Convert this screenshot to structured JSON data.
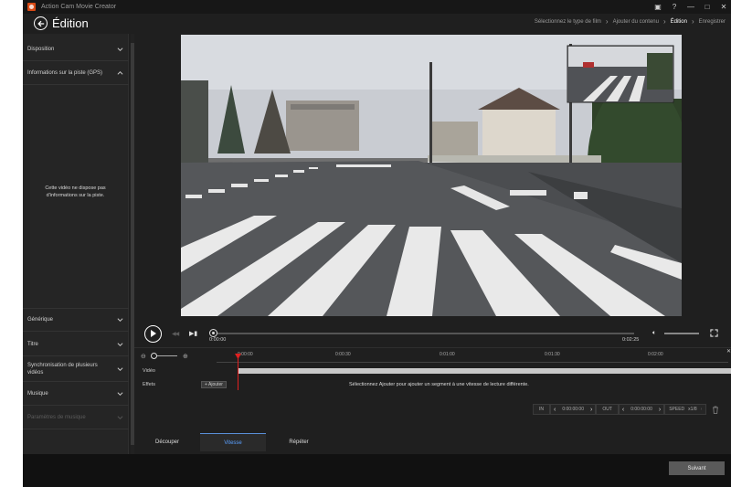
{
  "window": {
    "app_title": "Action Cam Movie Creator",
    "controls": [
      "toolbox",
      "help",
      "minimize",
      "maximize",
      "close"
    ]
  },
  "header": {
    "title": "Édition",
    "breadcrumb": [
      "Sélectionnez le type de film",
      "Ajouter du contenu",
      "Édition",
      "Enregistrer"
    ],
    "active_step": "Édition"
  },
  "left_panel": {
    "sections": [
      {
        "label": "Disposition",
        "expanded": false,
        "enabled": true
      },
      {
        "label": "Informations sur la piste (GPS)",
        "expanded": true,
        "enabled": true
      },
      {
        "label": "Générique",
        "expanded": false,
        "enabled": true
      },
      {
        "label": "Titre",
        "expanded": false,
        "enabled": true
      },
      {
        "label": "Synchronisation de plusieurs vidéos",
        "expanded": false,
        "enabled": true
      },
      {
        "label": "Musique",
        "expanded": false,
        "enabled": true
      },
      {
        "label": "Paramètres de musique",
        "expanded": false,
        "enabled": false
      }
    ],
    "gps_message": "Cette vidéo ne dispose pas d'informations sur la piste."
  },
  "player": {
    "current_time": "0:00:00",
    "total_time": "0:02:25",
    "progress": 0.0
  },
  "timeline": {
    "ruler_labels": [
      "0:00:00",
      "0:00:30",
      "0:01:00",
      "0:01:30",
      "0:02:00"
    ],
    "track_video_label": "Vidéo",
    "track_effects_label": "Effets",
    "add_button": "Ajouter",
    "hint": "Sélectionnez Ajouter pour ajouter un segment à une vitesse de lecture différente.",
    "in_label": "IN",
    "in_value": "0:00:00:00",
    "out_label": "OUT",
    "out_value": "0:00:00:00",
    "speed_label": "SPEED",
    "speed_value": "x1/8"
  },
  "tabs": [
    {
      "label": "Découper",
      "active": false
    },
    {
      "label": "Vitesse",
      "active": true
    },
    {
      "label": "Répéter",
      "active": false
    }
  ],
  "footer": {
    "next_button": "Suivant"
  },
  "colors": {
    "accent": "#5aa0ff",
    "playhead": "#e02020",
    "logo": "#d94b16"
  }
}
